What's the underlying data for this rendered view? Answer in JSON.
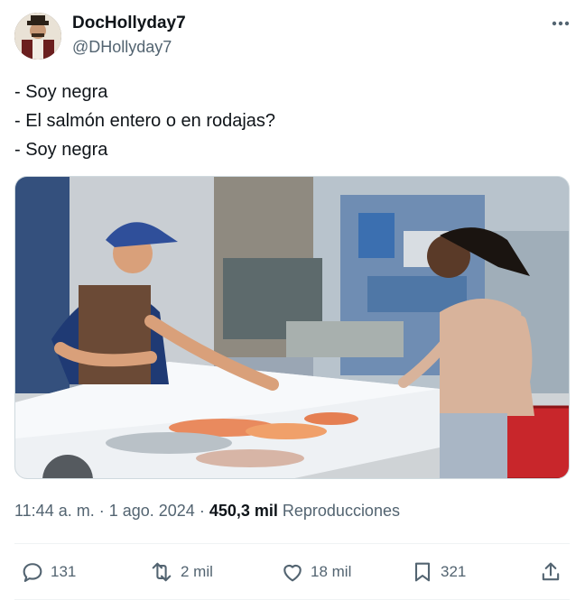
{
  "author": {
    "display_name": "DocHollyday7",
    "handle": "@DHollyday7",
    "avatar_icon": "user-avatar"
  },
  "menu_icon": "more-horizontal-icon",
  "tweet": {
    "lines": [
      "- Soy negra",
      "- El salmón entero o en rodajas?",
      "- Soy negra"
    ]
  },
  "meta": {
    "time": "11:44 a. m.",
    "separator": " · ",
    "date": "1 ago. 2024",
    "views_count": "450,3 mil",
    "views_label": "Reproducciones"
  },
  "actions": {
    "replies": "131",
    "reposts": "2 mil",
    "likes": "18 mil",
    "bookmarks": "321"
  },
  "colors": {
    "text": "#0f1419",
    "secondary": "#536471",
    "divider": "#eff3f4"
  }
}
